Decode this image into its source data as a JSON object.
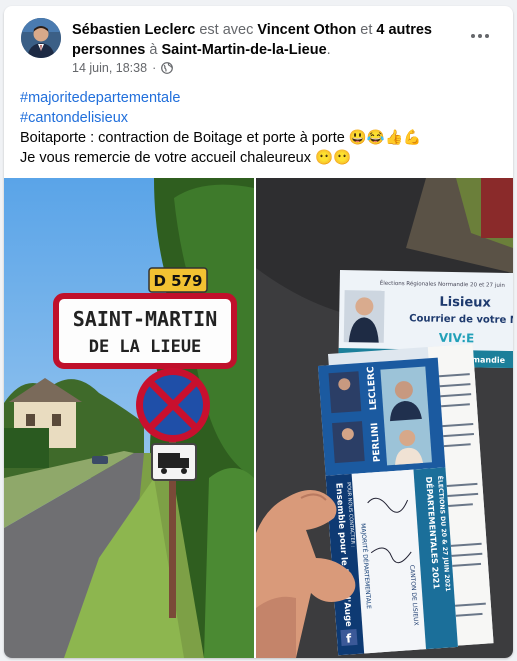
{
  "post": {
    "author": "Sébastien Leclerc",
    "with_text": "est avec",
    "tagged_person": "Vincent Othon",
    "and_text": "et",
    "others": "4 autres personnes",
    "at_text": "à",
    "location": "Saint-Martin-de-la-Lieue",
    "period": ".",
    "date": "14 juin, 18:38",
    "separator": "·",
    "privacy_icon": "globe-icon",
    "hashtags": [
      "#majoritedepartementale",
      "#cantondelisieux"
    ],
    "line1": "Boitaporte : contraction de Boitage et porte à porte 😃😂👍💪",
    "line2": "Je vous remercie de votre accueil chaleureux 😶😶"
  },
  "photo_sign": {
    "route_plate": "D 579",
    "town_line1": "SAINT-MARTIN",
    "town_line2": "DE LA LIEUE"
  },
  "photo_flyers": {
    "top_header": "Élections Régionales Normandie 20 et 27 juin",
    "top_city": "Lisieux",
    "top_subtitle": "Courrier de votre Ma",
    "top_brand": "VIV:E",
    "top_footer": "lanormandie",
    "side_name1": "LECLERC",
    "side_name2": "PERLINI",
    "band1": "DÉPARTEMENTALES 2021",
    "band2": "ÉLECTIONS DU 20 & 27 JUIN 2021",
    "band3": "CANTON DE LISIEUX",
    "slogan": "Ensemble pour le Pays d'Auge !",
    "majority": "MAJORITÉ DÉPARTEMENTALE",
    "contact": "POUR NOUS CONTACTER :",
    "fb": "f"
  },
  "colors": {
    "link": "#216fdb",
    "secondary_text": "#65676b",
    "sign_border": "#c0102b",
    "flyer_blue": "#0e3a73"
  }
}
